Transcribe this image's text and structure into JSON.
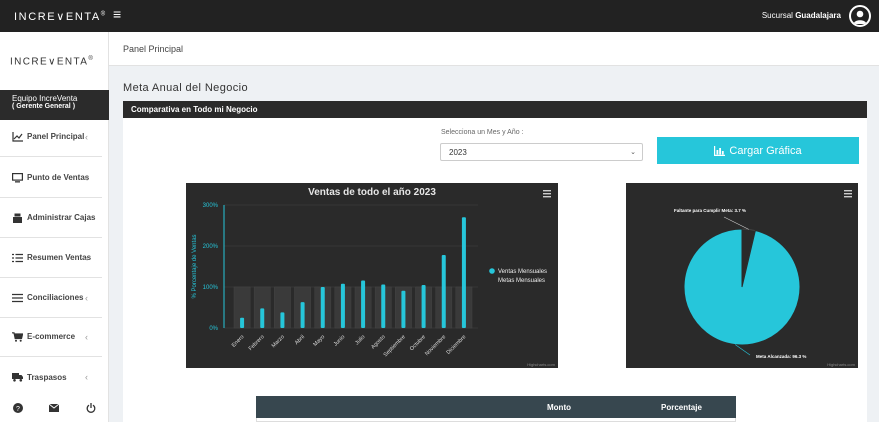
{
  "topbar": {
    "brand": "INCRE∨ENTA",
    "brand_mark": "®",
    "menu_icon": "hamburger-icon",
    "branch_prefix": "Sucursal ",
    "branch_name": "Guadalajara",
    "avatar_icon": "user-avatar-icon"
  },
  "sidebar": {
    "logo": "INCRE∨ENTA",
    "logo_mark": "®",
    "team_name": "Equipo IncreVenta",
    "team_role": "( Gerente General )",
    "items": [
      {
        "label": "Panel Principal",
        "icon": "chart-line-icon"
      },
      {
        "label": "Punto de Ventas",
        "icon": "monitor-icon"
      },
      {
        "label": "Administrar Cajas",
        "icon": "cash-register-icon"
      },
      {
        "label": "Resumen Ventas",
        "icon": "list-icon"
      },
      {
        "label": "Conciliaciones",
        "icon": "bars-icon"
      },
      {
        "label": "E-commerce",
        "icon": "cart-icon"
      },
      {
        "label": "Traspasos",
        "icon": "truck-icon"
      }
    ],
    "footer_icons": [
      "help-icon",
      "mail-icon",
      "power-icon"
    ]
  },
  "breadcrumb": "Panel Principal",
  "section_title": "Meta Anual del Negocio",
  "panel_title": "Comparativa en Todo mi Negocio",
  "filter": {
    "label": "Selecciona un Mes y Año :",
    "selected": "2023",
    "button": "Cargar Gráfica"
  },
  "colors": {
    "accent": "#26c6da",
    "dark": "#2a2a2a",
    "goal": "#3a3a3a"
  },
  "chart_data": [
    {
      "type": "bar",
      "title": "Ventas de todo el año 2023",
      "ylabel": "% Porcentaje de Ventas",
      "ylim": [
        0,
        300
      ],
      "yticks": [
        "0%",
        "100%",
        "200%",
        "300%"
      ],
      "categories": [
        "Enero",
        "Febrero",
        "Marzo",
        "Abril",
        "Mayo",
        "Junio",
        "Julio",
        "Agosto",
        "Septiembre",
        "Octubre",
        "Noviembre",
        "Diciembre"
      ],
      "series": [
        {
          "name": "Ventas Mensuales",
          "values": [
            25,
            48,
            38,
            63,
            100,
            108,
            116,
            106,
            91,
            105,
            178,
            270
          ]
        },
        {
          "name": "Metas Mensuales",
          "values": [
            100,
            100,
            100,
            100,
            100,
            100,
            100,
            100,
            100,
            100,
            100,
            100
          ]
        }
      ],
      "legend": "right",
      "credits": "Highcharts.com",
      "menu_icon": "chart-menu-icon"
    },
    {
      "type": "pie",
      "slices": [
        {
          "label": "Faltante para Cumplir Meta: 3.7 %",
          "value": 3.7
        },
        {
          "label": "Meta Alcanzada: 96.3 %",
          "value": 96.3
        }
      ],
      "credits": "Highcharts.com",
      "menu_icon": "chart-menu-icon"
    }
  ],
  "table": {
    "columns": [
      "Monto",
      "Porcentaje"
    ]
  }
}
